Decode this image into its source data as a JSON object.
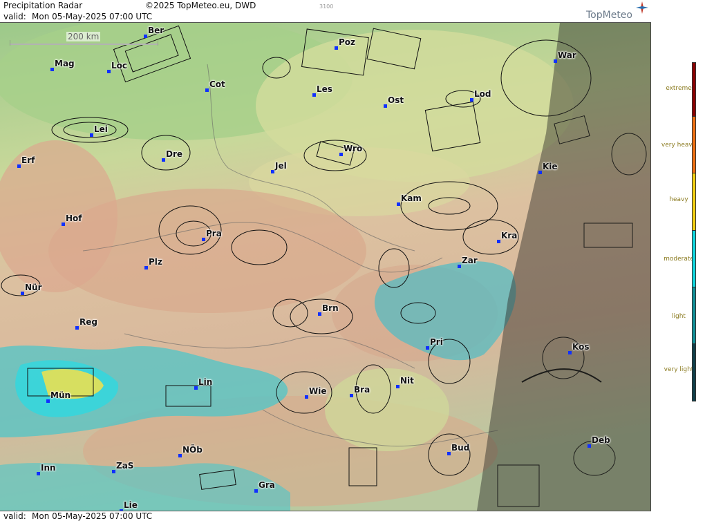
{
  "header": {
    "title": "Precipitation Radar",
    "copyright": "©2025 TopMeteo.eu, DWD",
    "code": "3100",
    "valid_label": "valid:",
    "valid_time": "Mon  05-May-2025 07:00 UTC",
    "logo_text": "TopMeteo"
  },
  "footer": {
    "valid_label": "valid:",
    "valid_time": "Mon  05-May-2025 07:00 UTC"
  },
  "scale": {
    "label": "200 km"
  },
  "legend": {
    "labels": [
      "extreme",
      "very heavy",
      "heavy",
      "moderate",
      "light",
      "very light"
    ],
    "colors": [
      "#8b0000",
      "#f07010",
      "#f4d010",
      "#10d8e0",
      "#109098",
      "#10404a"
    ]
  },
  "cities": [
    {
      "name": "Ber"
    },
    {
      "name": "Poz"
    },
    {
      "name": "War"
    },
    {
      "name": "Mag"
    },
    {
      "name": "Loc"
    },
    {
      "name": "Cot"
    },
    {
      "name": "Les"
    },
    {
      "name": "Ost"
    },
    {
      "name": "Lod"
    },
    {
      "name": "Lei"
    },
    {
      "name": "Dre"
    },
    {
      "name": "Wro"
    },
    {
      "name": "Erf"
    },
    {
      "name": "Jel"
    },
    {
      "name": "Kie"
    },
    {
      "name": "Kam"
    },
    {
      "name": "Hof"
    },
    {
      "name": "Pra"
    },
    {
      "name": "Kra"
    },
    {
      "name": "Zar"
    },
    {
      "name": "Plz"
    },
    {
      "name": "Nür"
    },
    {
      "name": "Brn"
    },
    {
      "name": "Reg"
    },
    {
      "name": "Kos"
    },
    {
      "name": "Pri"
    },
    {
      "name": "Lin"
    },
    {
      "name": "Nit"
    },
    {
      "name": "Mün"
    },
    {
      "name": "Wie"
    },
    {
      "name": "Bra"
    },
    {
      "name": "Bud"
    },
    {
      "name": "Deb"
    },
    {
      "name": "NÖb"
    },
    {
      "name": "ZaS"
    },
    {
      "name": "Inn"
    },
    {
      "name": "Gra"
    },
    {
      "name": "Lie"
    }
  ]
}
